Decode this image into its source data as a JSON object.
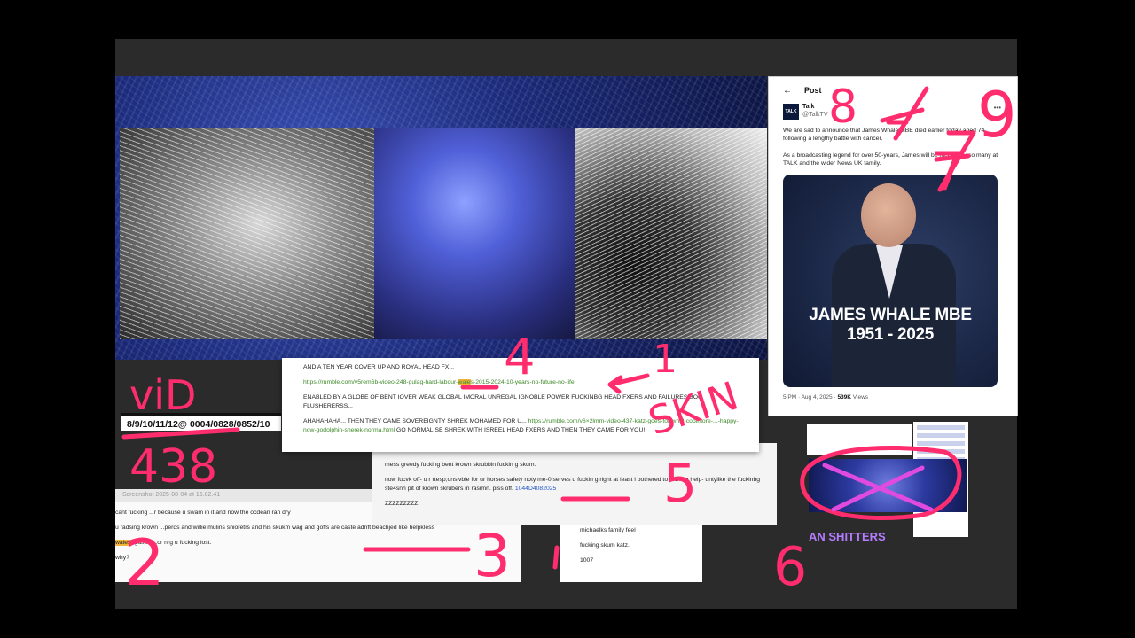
{
  "colors": {
    "annotation": "#ff2d6e",
    "link": "#3f8a2a",
    "highlight": "#f2b53a",
    "accent_blue": "#2458c8"
  },
  "tweet": {
    "back_icon": "arrow-left-icon",
    "title": "Post",
    "logo_text": "TALK",
    "account_name": "Talk",
    "handle": "@TalkTV",
    "menu": "•••",
    "paragraph1": "We are sad to announce that James Whale MBE died earlier today aged 74, following a lengthy battle with cancer.",
    "paragraph2": "As a broadcasting legend for over 50-years, James will be missed by so many at TALK and the wider News UK family.",
    "card_line1": "JAMES WHALE MBE",
    "card_line2": "1951 - 2025",
    "footer_time": "5 PM · Aug 4, 2025 ·",
    "footer_views": "539K",
    "footer_views_label": "Views"
  },
  "label_strip": {
    "text": "8/9/10/11/12@ 0004/0828/0852/10"
  },
  "doc1": {
    "line1": "AND A TEN YEAR COVER UP AND ROYAL HEAD FX...",
    "link1_pre": "https://rumble.com/v5rem6b-video-248-gulag-hard-labour-",
    "link1_hl": "wale",
    "link1_post": "s-2015-2024-10-years-no-future-no-life",
    "line2": "ENABLED BY A GLOBE OF BENT IOVER WEAK GLOBAL IMORAL UNREGAL IGNOBLE POWER FUCKINBG HEAD FXERS AND FAILURES BOG FLUSHERERSS...",
    "line3_pre": "AHAHAHAHA... THEN THEY CAME SOVEREIGNTY SHREK MOHAMED FOR U...",
    "link2": "https://rumble.com/v6×2lmm-video-437-katz-goes-for-whirl-coolmore-...-happy-now-godolphin-sherek-norma.html",
    "line3_post": "GO NORMALISE SHREK WITH ISREEL HEAD FXERS AND THEN THEY CAME FOR YOU!"
  },
  "doc2": {
    "line1": "mess greedy fucking bent krown skrubbin fuckin g skum.",
    "line2": "now fucvk off- u r rtesp;onsivble for ur horses safety noty me-0 serves u fuckin g right at least i bothered to fucking help- untylike the fuckinbg ste4snh pit of krown skrubers in rasimn. piss off.",
    "code": "1044D4082025",
    "line3": "ZZZZZZZZZ"
  },
  "doc3": {
    "title": "Screenshot 2025-08-04 at 16.02.41",
    "line1": "cant fucking ...r because u swam in it and now the ocdean ran dry",
    "line2": "u radsing krown ...perds and willie mulins snioretrs and his skukm wag and goffs are caste adrift beachjed like helpkless",
    "hl": "wales",
    "line3": "- gaspin...or nrg u fucking lost.",
    "line4": "why?"
  },
  "doc4": {
    "line1": "anythin to do with selfish fuckers who watc... michaelks family feel",
    "line2": "fucking skum katz.",
    "line3": "1007"
  },
  "thumb": {
    "label": "AN SHITTERS"
  },
  "annotations": {
    "n8": "8",
    "n9": "9",
    "n7": "7",
    "n4": "4",
    "n1": "1",
    "vid": "viD",
    "n438": "438",
    "n2": "2",
    "n3": "3",
    "n5": "5",
    "n6": "6",
    "skin": "SKIN"
  }
}
